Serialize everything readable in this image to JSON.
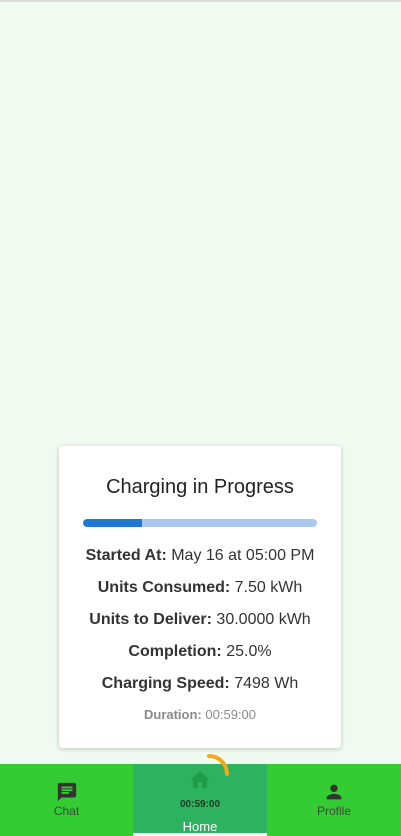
{
  "card": {
    "title": "Charging in Progress",
    "progress_fraction": 0.25,
    "started_label": "Started At:",
    "started_value": "May 16 at 05:00 PM",
    "consumed_label": "Units Consumed:",
    "consumed_value": "7.50 kWh",
    "deliver_label": "Units to Deliver:",
    "deliver_value": "30.0000 kWh",
    "completion_label": "Completion:",
    "completion_value": "25.0%",
    "speed_label": "Charging Speed:",
    "speed_value": "7498 Wh",
    "duration_label": "Duration:",
    "duration_value": "00:59:00"
  },
  "nav": {
    "chat_label": "Chat",
    "chat_icon": "chat-icon",
    "home_label": "Home",
    "home_icon": "home-icon",
    "home_timer": "00:59:00",
    "home_progress_fraction": 0.25,
    "profile_label": "Profile",
    "profile_icon": "person-icon"
  },
  "colors": {
    "background": "#f0faf1",
    "nav_bar": "#33cc33",
    "nav_active": "#2db360",
    "progress_fill": "#1e78d0",
    "progress_track": "#a9c8ec",
    "timer_arc": "#f2a81d"
  }
}
